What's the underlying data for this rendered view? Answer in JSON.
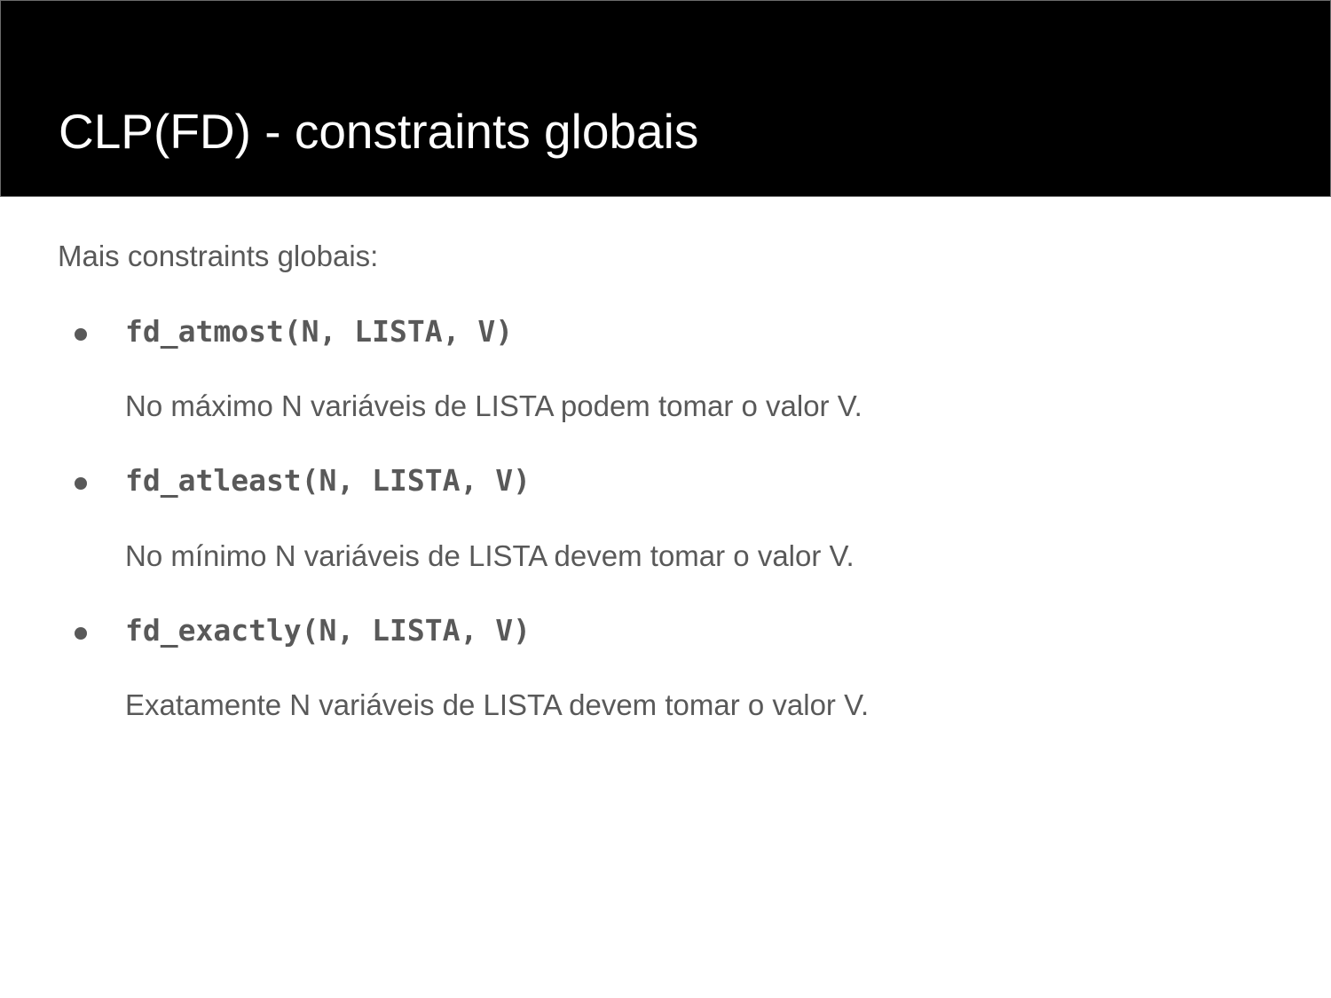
{
  "slide": {
    "title": "CLP(FD) - constraints globais",
    "intro": "Mais constraints globais:",
    "items": [
      {
        "signature": "fd_atmost(N, LISTA, V)",
        "description": "No máximo N variáveis de LISTA podem tomar o valor V."
      },
      {
        "signature": "fd_atleast(N, LISTA, V)",
        "description": "No mínimo N variáveis de LISTA devem tomar o valor V."
      },
      {
        "signature": "fd_exactly(N, LISTA, V)",
        "description": "Exatamente N variáveis de LISTA devem tomar o valor V."
      }
    ]
  }
}
